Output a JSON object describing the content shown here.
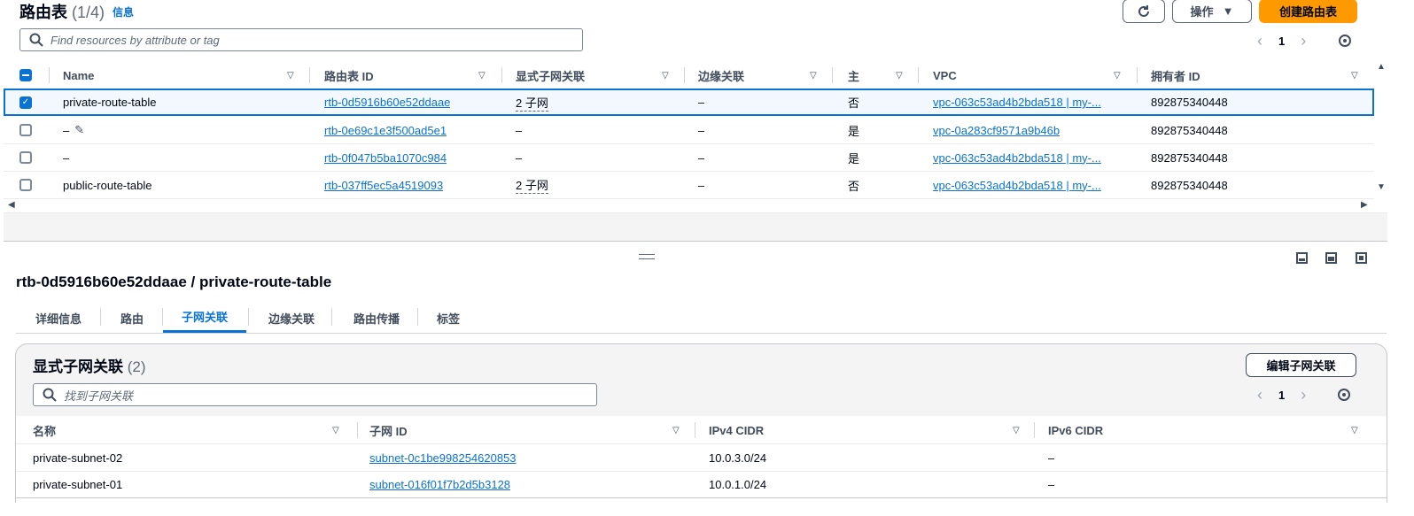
{
  "header": {
    "title": "路由表",
    "count": "(1/4)",
    "info_link": "信息",
    "actions_label": "操作",
    "create_label": "创建路由表"
  },
  "search": {
    "placeholder": "Find resources by attribute or tag"
  },
  "pager": {
    "page": "1"
  },
  "table": {
    "columns": [
      "Name",
      "路由表 ID",
      "显式子网关联",
      "边缘关联",
      "主",
      "VPC",
      "拥有者 ID"
    ],
    "rows": [
      {
        "selected": true,
        "name": "private-route-table",
        "id": "rtb-0d5916b60e52ddaae",
        "subnets": "2 子网",
        "edge": "–",
        "main": "否",
        "vpc": "vpc-063c53ad4b2bda518 | my-...",
        "owner": "892875340448"
      },
      {
        "selected": false,
        "name": "–",
        "id": "rtb-0e69c1e3f500ad5e1",
        "subnets": "–",
        "edge": "–",
        "main": "是",
        "vpc": "vpc-0a283cf9571a9b46b",
        "owner": "892875340448"
      },
      {
        "selected": false,
        "name": "–",
        "id": "rtb-0f047b5ba1070c984",
        "subnets": "–",
        "edge": "–",
        "main": "是",
        "vpc": "vpc-063c53ad4b2bda518 | my-...",
        "owner": "892875340448"
      },
      {
        "selected": false,
        "name": "public-route-table",
        "id": "rtb-037ff5ec5a4519093",
        "subnets": "2 子网",
        "edge": "–",
        "main": "否",
        "vpc": "vpc-063c53ad4b2bda518 | my-...",
        "owner": "892875340448"
      }
    ]
  },
  "detail": {
    "title": "rtb-0d5916b60e52ddaae / private-route-table",
    "tabs": [
      "详细信息",
      "路由",
      "子网关联",
      "边缘关联",
      "路由传播",
      "标签"
    ],
    "active_tab": "子网关联"
  },
  "subnet_panel": {
    "title": "显式子网关联",
    "count": "(2)",
    "edit_label": "编辑子网关联",
    "search_placeholder": "找到子网关联",
    "page": "1",
    "columns": [
      "名称",
      "子网 ID",
      "IPv4 CIDR",
      "IPv6 CIDR"
    ],
    "rows": [
      {
        "name": "private-subnet-02",
        "id": "subnet-0c1be998254620853",
        "ipv4": "10.0.3.0/24",
        "ipv6": "–"
      },
      {
        "name": "private-subnet-01",
        "id": "subnet-016f01f7b2d5b3128",
        "ipv4": "10.0.1.0/24",
        "ipv6": "–"
      }
    ]
  },
  "colors": {
    "accent": "#0972d3",
    "primary_button": "#ff9900"
  }
}
